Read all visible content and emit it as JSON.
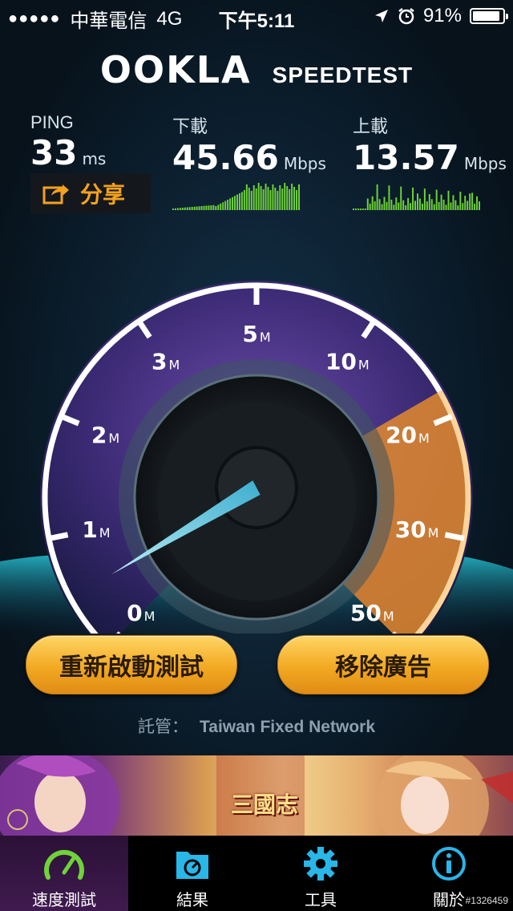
{
  "status_bar": {
    "signal": "●●●●●",
    "carrier": "中華電信",
    "network": "4G",
    "time": "下午5:11",
    "battery_percent": "91%",
    "battery_level": 0.91
  },
  "header": {
    "logo": "OOKLA",
    "subtitle": "SPEEDTEST"
  },
  "ping": {
    "label": "PING",
    "value": "33",
    "unit": "ms"
  },
  "download": {
    "label": "下載",
    "value": "45.66",
    "unit": "Mbps"
  },
  "upload": {
    "label": "上載",
    "value": "13.57",
    "unit": "Mbps"
  },
  "share": {
    "label": "分享"
  },
  "gauge": {
    "ticks": [
      {
        "num": "0",
        "unit": "M"
      },
      {
        "num": "1",
        "unit": "M"
      },
      {
        "num": "2",
        "unit": "M"
      },
      {
        "num": "3",
        "unit": "M"
      },
      {
        "num": "5",
        "unit": "M"
      },
      {
        "num": "10",
        "unit": "M"
      },
      {
        "num": "20",
        "unit": "M"
      },
      {
        "num": "30",
        "unit": "M"
      },
      {
        "num": "50",
        "unit": "M"
      }
    ]
  },
  "buttons": {
    "restart": "重新啟動測試",
    "remove_ads": "移除廣告"
  },
  "host": {
    "label": "託管：",
    "isp": "Taiwan Fixed Network"
  },
  "ad": {
    "text": "三國志"
  },
  "tabs": [
    {
      "label": "速度測試",
      "icon": "speedometer-icon",
      "active": true
    },
    {
      "label": "結果",
      "icon": "folder-icon",
      "active": false
    },
    {
      "label": "工具",
      "icon": "gear-icon",
      "active": false
    },
    {
      "label": "關於",
      "icon": "info-icon",
      "active": false
    }
  ],
  "image_id": "#1326459",
  "colors": {
    "accent_orange": "#f4a21e",
    "download_green": "#6fd23a",
    "tab_active": "#3f1a4f",
    "tab_icon": "#29b6e8"
  }
}
